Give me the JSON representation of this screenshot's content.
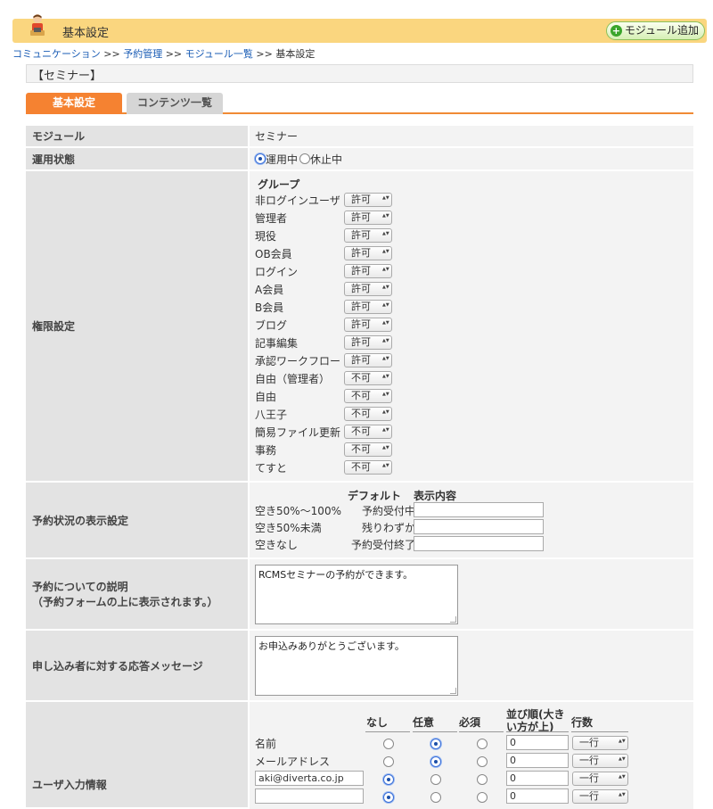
{
  "header": {
    "title": "基本設定",
    "add_module_label": "モジュール追加"
  },
  "breadcrumb": {
    "items": [
      "コミュニケーション",
      "予約管理",
      "モジュール一覧"
    ],
    "separator": ">>",
    "current": "基本設定"
  },
  "page_title": "【セミナー】",
  "tabs": {
    "active": "基本設定",
    "inactive": "コンテンツ一覧"
  },
  "form": {
    "module": {
      "label": "モジュール",
      "value": "セミナー"
    },
    "status": {
      "label": "運用状態",
      "options": [
        "運用中",
        "休止中"
      ],
      "selected": "運用中"
    },
    "permissions": {
      "label": "権限設定",
      "header": "グループ",
      "groups": [
        {
          "name": "非ログインユーザ",
          "value": "許可"
        },
        {
          "name": "管理者",
          "value": "許可"
        },
        {
          "name": "現役",
          "value": "許可"
        },
        {
          "name": "OB会員",
          "value": "許可"
        },
        {
          "name": "ログイン",
          "value": "許可"
        },
        {
          "name": "A会員",
          "value": "許可"
        },
        {
          "name": "B会員",
          "value": "許可"
        },
        {
          "name": "ブログ",
          "value": "許可"
        },
        {
          "name": "記事編集",
          "value": "許可"
        },
        {
          "name": "承認ワークフロー",
          "value": "許可"
        },
        {
          "name": "自由（管理者）",
          "value": "不可"
        },
        {
          "name": "自由",
          "value": "不可"
        },
        {
          "name": "八王子",
          "value": "不可"
        },
        {
          "name": "簡易ファイル更新",
          "value": "不可"
        },
        {
          "name": "事務",
          "value": "不可"
        },
        {
          "name": "てすと",
          "value": "不可"
        }
      ]
    },
    "display": {
      "label": "予約状況の表示設定",
      "col_default": "デフォルト",
      "col_content": "表示内容",
      "rows": [
        {
          "condition": "空き50%〜100%",
          "default": "予約受付中",
          "value": ""
        },
        {
          "condition": "空き50%未満",
          "default": "残りわずか",
          "value": ""
        },
        {
          "condition": "空きなし",
          "default": "予約受付終了",
          "value": ""
        }
      ]
    },
    "description": {
      "label_line1": "予約についての説明",
      "label_line2": "（予約フォームの上に表示されます。）",
      "value": "RCMSセミナーの予約ができます。"
    },
    "response": {
      "label": "申し込み者に対する応答メッセージ",
      "value": "お申込みありがとうございます。"
    },
    "user_input": {
      "label": "ユーザ入力情報",
      "cols": [
        "なし",
        "任意",
        "必須",
        "並び順(大きい方が上)",
        "行数"
      ],
      "order_col_line1": "並び順(大き",
      "order_col_line2": "い方が上)",
      "rows": [
        {
          "name": "名前",
          "selected": 1,
          "order": "0",
          "lines": "一行"
        },
        {
          "name": "メールアドレス",
          "selected": 1,
          "order": "0",
          "lines": "一行"
        },
        {
          "name": "aki@diverta.co.jp",
          "editable": true,
          "selected": 0,
          "order": "0",
          "lines": "一行"
        },
        {
          "name": "",
          "editable": true,
          "selected": 0,
          "order": "0",
          "lines": "一行"
        }
      ]
    }
  },
  "colors": {
    "accent_orange": "#f58231",
    "header_yellow": "#fad67f",
    "link_blue": "#1a5cb5"
  }
}
